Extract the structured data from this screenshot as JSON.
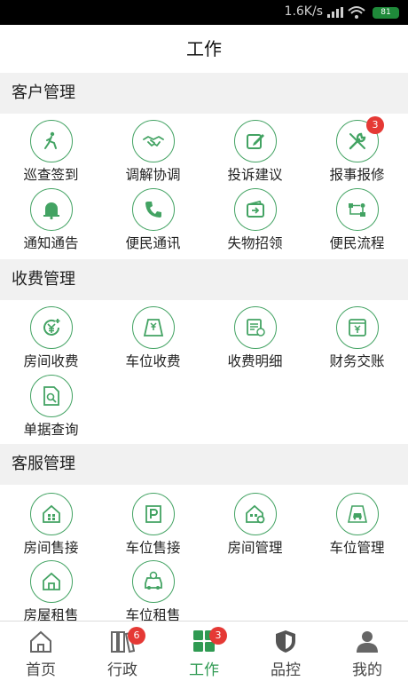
{
  "status_bar": {
    "speed": "1.6K/s",
    "battery": "81"
  },
  "page_title": "工作",
  "sections": [
    {
      "title": "客户管理",
      "items": [
        {
          "label": "巡查签到",
          "icon": "patrol-icon"
        },
        {
          "label": "调解协调",
          "icon": "handshake-icon"
        },
        {
          "label": "投诉建议",
          "icon": "edit-icon"
        },
        {
          "label": "报事报修",
          "icon": "wrench-icon",
          "badge": "3"
        },
        {
          "label": "通知通告",
          "icon": "bell-icon"
        },
        {
          "label": "便民通讯",
          "icon": "phone-icon"
        },
        {
          "label": "失物招领",
          "icon": "wallet-icon"
        },
        {
          "label": "便民流程",
          "icon": "flow-icon"
        }
      ]
    },
    {
      "title": "收费管理",
      "items": [
        {
          "label": "房间收费",
          "icon": "yuan-coin-icon"
        },
        {
          "label": "车位收费",
          "icon": "parking-fee-icon"
        },
        {
          "label": "收费明细",
          "icon": "receipt-icon"
        },
        {
          "label": "财务交账",
          "icon": "ledger-icon"
        },
        {
          "label": "单据查询",
          "icon": "document-search-icon"
        }
      ]
    },
    {
      "title": "客服管理",
      "items": [
        {
          "label": "房间售接",
          "icon": "house-icon"
        },
        {
          "label": "车位售接",
          "icon": "parking-icon"
        },
        {
          "label": "房间管理",
          "icon": "house-settings-icon"
        },
        {
          "label": "车位管理",
          "icon": "car-icon"
        },
        {
          "label": "房屋租售",
          "icon": "house-rent-icon"
        },
        {
          "label": "车位租售",
          "icon": "car-rent-icon"
        }
      ]
    }
  ],
  "tabs": [
    {
      "label": "首页",
      "icon": "home-icon"
    },
    {
      "label": "行政",
      "icon": "binders-icon",
      "badge": "6"
    },
    {
      "label": "工作",
      "icon": "grid-icon",
      "badge": "3",
      "active": true
    },
    {
      "label": "品控",
      "icon": "shield-icon"
    },
    {
      "label": "我的",
      "icon": "user-icon"
    }
  ],
  "colors": {
    "accent": "#2f9a52",
    "badge": "#e53935",
    "section_bg": "#f1f1f1"
  }
}
